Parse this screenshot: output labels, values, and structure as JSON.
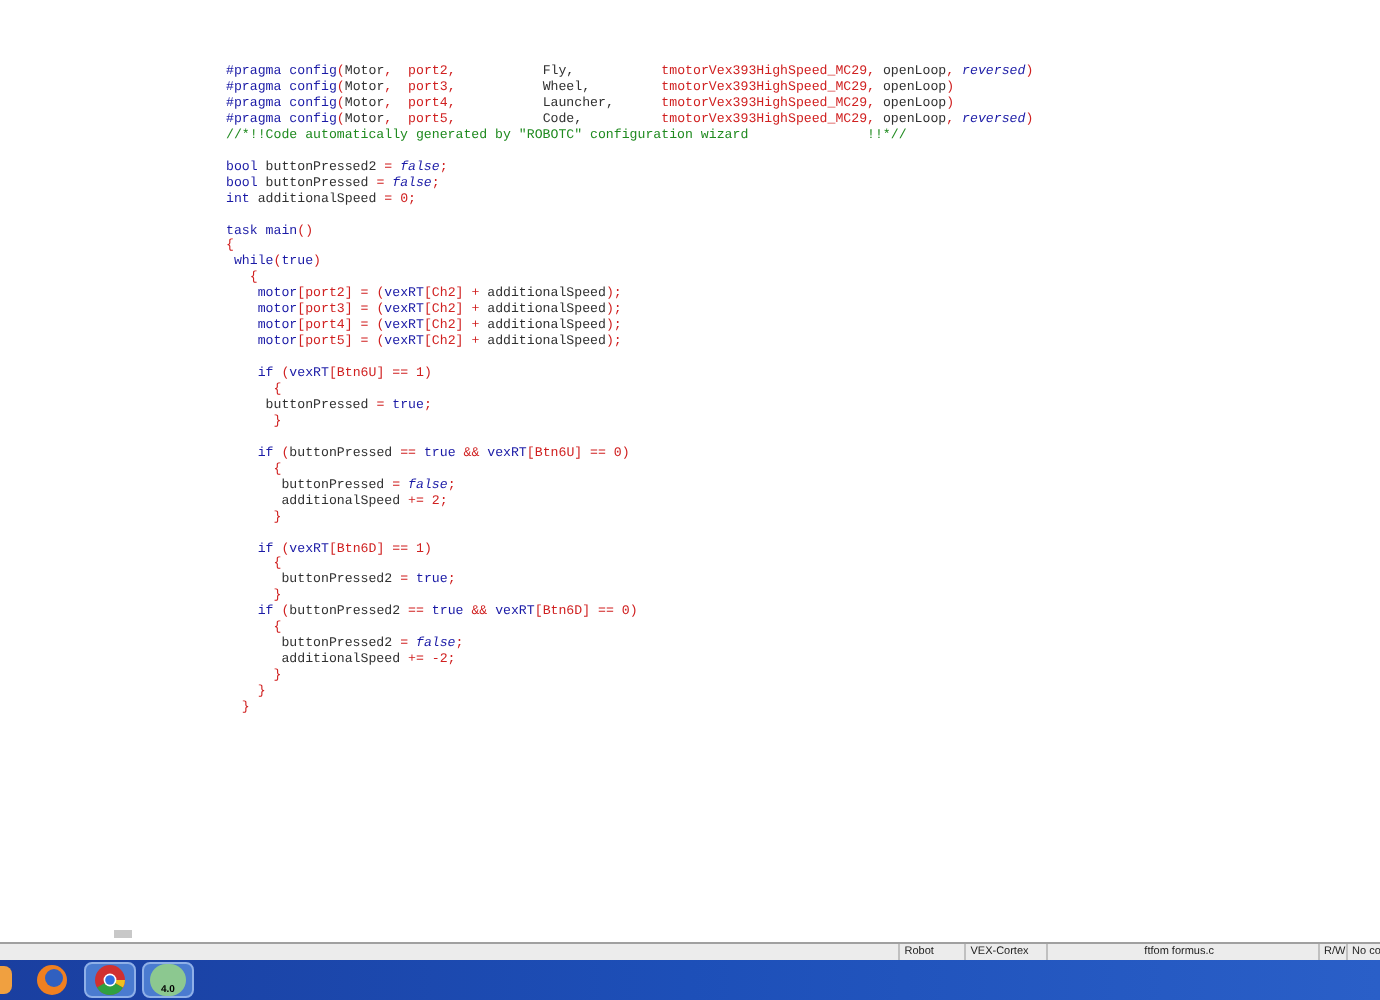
{
  "code_blocks": [
    [
      [
        {
          "kind": "kw",
          "text": "#pragma config"
        },
        {
          "kind": "op",
          "text": "("
        },
        {
          "kind": "id",
          "text": "Motor"
        },
        {
          "kind": "op",
          "text": ",  port2,           "
        },
        {
          "kind": "id",
          "text": "Fly,           "
        },
        {
          "kind": "op",
          "text": "tmotorVex393HighSpeed_MC29, "
        },
        {
          "kind": "id",
          "text": "openLoop"
        },
        {
          "kind": "op",
          "text": ", "
        },
        {
          "kind": "lit",
          "text": "reversed"
        },
        {
          "kind": "op",
          "text": ")"
        }
      ],
      [
        {
          "kind": "kw",
          "text": "#pragma config"
        },
        {
          "kind": "op",
          "text": "("
        },
        {
          "kind": "id",
          "text": "Motor"
        },
        {
          "kind": "op",
          "text": ",  port3,           "
        },
        {
          "kind": "id",
          "text": "Wheel,         "
        },
        {
          "kind": "op",
          "text": "tmotorVex393HighSpeed_MC29, "
        },
        {
          "kind": "id",
          "text": "openLoop"
        },
        {
          "kind": "op",
          "text": ")"
        }
      ],
      [
        {
          "kind": "kw",
          "text": "#pragma config"
        },
        {
          "kind": "op",
          "text": "("
        },
        {
          "kind": "id",
          "text": "Motor"
        },
        {
          "kind": "op",
          "text": ",  port4,           "
        },
        {
          "kind": "id",
          "text": "Launcher,      "
        },
        {
          "kind": "op",
          "text": "tmotorVex393HighSpeed_MC29, "
        },
        {
          "kind": "id",
          "text": "openLoop"
        },
        {
          "kind": "op",
          "text": ")"
        }
      ],
      [
        {
          "kind": "kw",
          "text": "#pragma config"
        },
        {
          "kind": "op",
          "text": "("
        },
        {
          "kind": "id",
          "text": "Motor"
        },
        {
          "kind": "op",
          "text": ",  port5,           "
        },
        {
          "kind": "id",
          "text": "Code,          "
        },
        {
          "kind": "op",
          "text": "tmotorVex393HighSpeed_MC29, "
        },
        {
          "kind": "id",
          "text": "openLoop"
        },
        {
          "kind": "op",
          "text": ", "
        },
        {
          "kind": "lit",
          "text": "reversed"
        },
        {
          "kind": "op",
          "text": ")"
        }
      ],
      [
        {
          "kind": "cm",
          "text": "//*!!Code automatically generated by \"ROBOTC\" configuration wizard               !!*//"
        }
      ]
    ],
    [
      [
        {
          "kind": "kw",
          "text": "bool"
        },
        {
          "kind": "id",
          "text": " buttonPressed2 "
        },
        {
          "kind": "op",
          "text": "= "
        },
        {
          "kind": "lit",
          "text": "false"
        },
        {
          "kind": "op",
          "text": ";"
        }
      ],
      [
        {
          "kind": "kw",
          "text": "bool"
        },
        {
          "kind": "id",
          "text": " buttonPressed "
        },
        {
          "kind": "op",
          "text": "= "
        },
        {
          "kind": "lit",
          "text": "false"
        },
        {
          "kind": "op",
          "text": ";"
        }
      ],
      [
        {
          "kind": "kw",
          "text": "int"
        },
        {
          "kind": "id",
          "text": " additionalSpeed "
        },
        {
          "kind": "op",
          "text": "= 0;"
        }
      ]
    ],
    [
      [
        {
          "kind": "kw",
          "text": "task main"
        },
        {
          "kind": "op",
          "text": "()"
        }
      ],
      [
        {
          "kind": "op",
          "text": "{"
        }
      ],
      [
        {
          "kind": "kw",
          "text": " while"
        },
        {
          "kind": "op",
          "text": "("
        },
        {
          "kind": "kw",
          "text": "true"
        },
        {
          "kind": "op",
          "text": ")"
        }
      ],
      [
        {
          "kind": "op",
          "text": "   {"
        }
      ],
      [
        {
          "kind": "kw",
          "text": "    motor"
        },
        {
          "kind": "op",
          "text": "[port2] = ("
        },
        {
          "kind": "kw",
          "text": "vexRT"
        },
        {
          "kind": "op",
          "text": "[Ch2] + "
        },
        {
          "kind": "id",
          "text": "additionalSpeed"
        },
        {
          "kind": "op",
          "text": ");"
        }
      ],
      [
        {
          "kind": "kw",
          "text": "    motor"
        },
        {
          "kind": "op",
          "text": "[port3] = ("
        },
        {
          "kind": "kw",
          "text": "vexRT"
        },
        {
          "kind": "op",
          "text": "[Ch2] + "
        },
        {
          "kind": "id",
          "text": "additionalSpeed"
        },
        {
          "kind": "op",
          "text": ");"
        }
      ],
      [
        {
          "kind": "kw",
          "text": "    motor"
        },
        {
          "kind": "op",
          "text": "[port4] = ("
        },
        {
          "kind": "kw",
          "text": "vexRT"
        },
        {
          "kind": "op",
          "text": "[Ch2] + "
        },
        {
          "kind": "id",
          "text": "additionalSpeed"
        },
        {
          "kind": "op",
          "text": ");"
        }
      ],
      [
        {
          "kind": "kw",
          "text": "    motor"
        },
        {
          "kind": "op",
          "text": "[port5] = ("
        },
        {
          "kind": "kw",
          "text": "vexRT"
        },
        {
          "kind": "op",
          "text": "[Ch2] + "
        },
        {
          "kind": "id",
          "text": "additionalSpeed"
        },
        {
          "kind": "op",
          "text": ");"
        }
      ]
    ],
    [
      [
        {
          "kind": "kw",
          "text": "    if"
        },
        {
          "kind": "op",
          "text": " ("
        },
        {
          "kind": "kw",
          "text": "vexRT"
        },
        {
          "kind": "op",
          "text": "[Btn6U] == 1)"
        }
      ],
      [
        {
          "kind": "op",
          "text": "      {"
        }
      ],
      [
        {
          "kind": "id",
          "text": "     buttonPressed "
        },
        {
          "kind": "op",
          "text": "= "
        },
        {
          "kind": "kw",
          "text": "true"
        },
        {
          "kind": "op",
          "text": ";"
        }
      ],
      [
        {
          "kind": "op",
          "text": "      }"
        }
      ]
    ],
    [
      [
        {
          "kind": "kw",
          "text": "    if"
        },
        {
          "kind": "op",
          "text": " ("
        },
        {
          "kind": "id",
          "text": "buttonPressed "
        },
        {
          "kind": "op",
          "text": "== "
        },
        {
          "kind": "kw",
          "text": "true"
        },
        {
          "kind": "op",
          "text": " && "
        },
        {
          "kind": "kw",
          "text": "vexRT"
        },
        {
          "kind": "op",
          "text": "[Btn6U] == 0)"
        }
      ],
      [
        {
          "kind": "op",
          "text": "      {"
        }
      ],
      [
        {
          "kind": "id",
          "text": "       buttonPressed "
        },
        {
          "kind": "op",
          "text": "= "
        },
        {
          "kind": "lit",
          "text": "false"
        },
        {
          "kind": "op",
          "text": ";"
        }
      ],
      [
        {
          "kind": "id",
          "text": "       additionalSpeed "
        },
        {
          "kind": "op",
          "text": "+= 2;"
        }
      ],
      [
        {
          "kind": "op",
          "text": "      }"
        }
      ]
    ],
    [
      [
        {
          "kind": "kw",
          "text": "    if"
        },
        {
          "kind": "op",
          "text": " ("
        },
        {
          "kind": "kw",
          "text": "vexRT"
        },
        {
          "kind": "op",
          "text": "[Btn6D] == 1)"
        }
      ],
      [
        {
          "kind": "op",
          "text": "      {"
        }
      ],
      [
        {
          "kind": "id",
          "text": "       buttonPressed2 "
        },
        {
          "kind": "op",
          "text": "= "
        },
        {
          "kind": "kw",
          "text": "true"
        },
        {
          "kind": "op",
          "text": ";"
        }
      ],
      [
        {
          "kind": "op",
          "text": "      }"
        }
      ],
      [
        {
          "kind": "kw",
          "text": "    if"
        },
        {
          "kind": "op",
          "text": " ("
        },
        {
          "kind": "id",
          "text": "buttonPressed2 "
        },
        {
          "kind": "op",
          "text": "== "
        },
        {
          "kind": "kw",
          "text": "true"
        },
        {
          "kind": "op",
          "text": " && "
        },
        {
          "kind": "kw",
          "text": "vexRT"
        },
        {
          "kind": "op",
          "text": "[Btn6D] == 0)"
        }
      ],
      [
        {
          "kind": "op",
          "text": "      {"
        }
      ],
      [
        {
          "kind": "id",
          "text": "       buttonPressed2 "
        },
        {
          "kind": "op",
          "text": "= "
        },
        {
          "kind": "lit",
          "text": "false"
        },
        {
          "kind": "op",
          "text": ";"
        }
      ],
      [
        {
          "kind": "id",
          "text": "       additionalSpeed "
        },
        {
          "kind": "op",
          "text": "+= -2;"
        }
      ],
      [
        {
          "kind": "op",
          "text": "      }"
        }
      ],
      [
        {
          "kind": "op",
          "text": "    }"
        }
      ],
      [
        {
          "kind": "op",
          "text": "  }"
        }
      ]
    ]
  ],
  "status_bar": [
    "Robot",
    "VEX-Cortex",
    "ftfom formus.c",
    "R/W",
    "No co"
  ],
  "taskbar": {
    "apps": [
      {
        "kind": "partial",
        "selected": false
      },
      {
        "kind": "firefox",
        "selected": false
      },
      {
        "kind": "chrome",
        "selected": true
      },
      {
        "kind": "robotc",
        "selected": true,
        "badge": "4.0"
      }
    ]
  }
}
